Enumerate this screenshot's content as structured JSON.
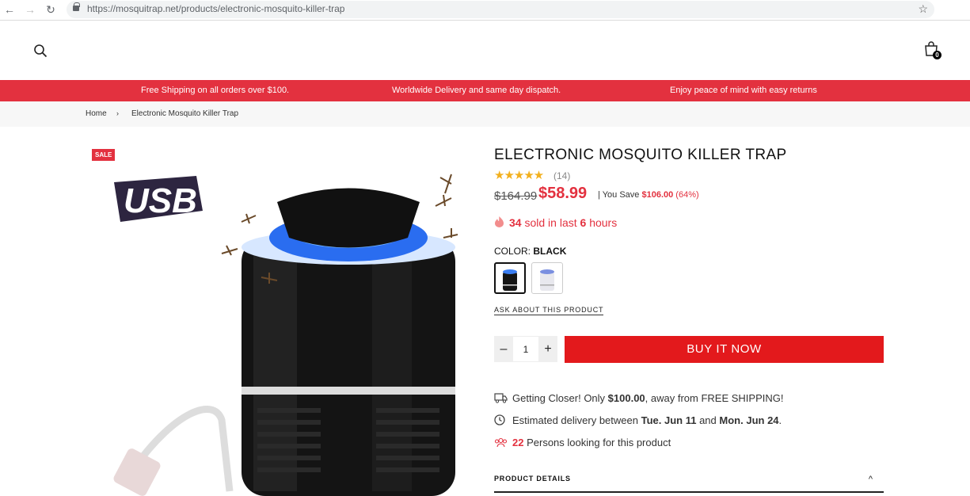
{
  "browser": {
    "url": "https://mosquitrap.net/products/electronic-mosquito-killer-trap"
  },
  "header": {
    "cart_count": "0"
  },
  "promo": [
    "Free Shipping on all orders over $100.",
    "Worldwide Delivery and same day dispatch.",
    "Enjoy peace of mind with easy returns"
  ],
  "breadcrumb": {
    "home": "Home",
    "sep": "›",
    "current": "Electronic Mosquito Killer Trap"
  },
  "product": {
    "sale_badge": "SALE",
    "usb_text": "USB",
    "title": "ELECTRONIC MOSQUITO KILLER TRAP",
    "rating": 5,
    "stars": "★★★★★",
    "review_count": "(14)",
    "old_price": "$164.99",
    "price": "$58.99",
    "save_prefix": "| You Save",
    "save_amount": "$106.00",
    "save_pct": "(64%)",
    "sold_count": "34",
    "sold_mid": "sold in last",
    "sold_hours": "6",
    "sold_suffix": "hours",
    "color_label": "COLOR:",
    "color_value": "BLACK",
    "ask": "ASK ABOUT THIS PRODUCT",
    "qty": "1",
    "qty_minus": "–",
    "qty_plus": "+",
    "buy": "BUY IT NOW"
  },
  "info": {
    "shipping_pre": "Getting Closer! Only",
    "shipping_amt": "$100.00",
    "shipping_post": ", away from FREE SHIPPING!",
    "delivery_pre": "Estimated delivery between",
    "delivery_from": "Tue. Jun 11",
    "delivery_and": "and",
    "delivery_to": "Mon. Jun 24",
    "delivery_end": ".",
    "persons_count": "22",
    "persons_text": "Persons looking for this product"
  },
  "details": {
    "label": "PRODUCT DETAILS",
    "chevron": "^"
  },
  "colors": {
    "accent": "#e3313f",
    "buy": "#e3191c"
  }
}
